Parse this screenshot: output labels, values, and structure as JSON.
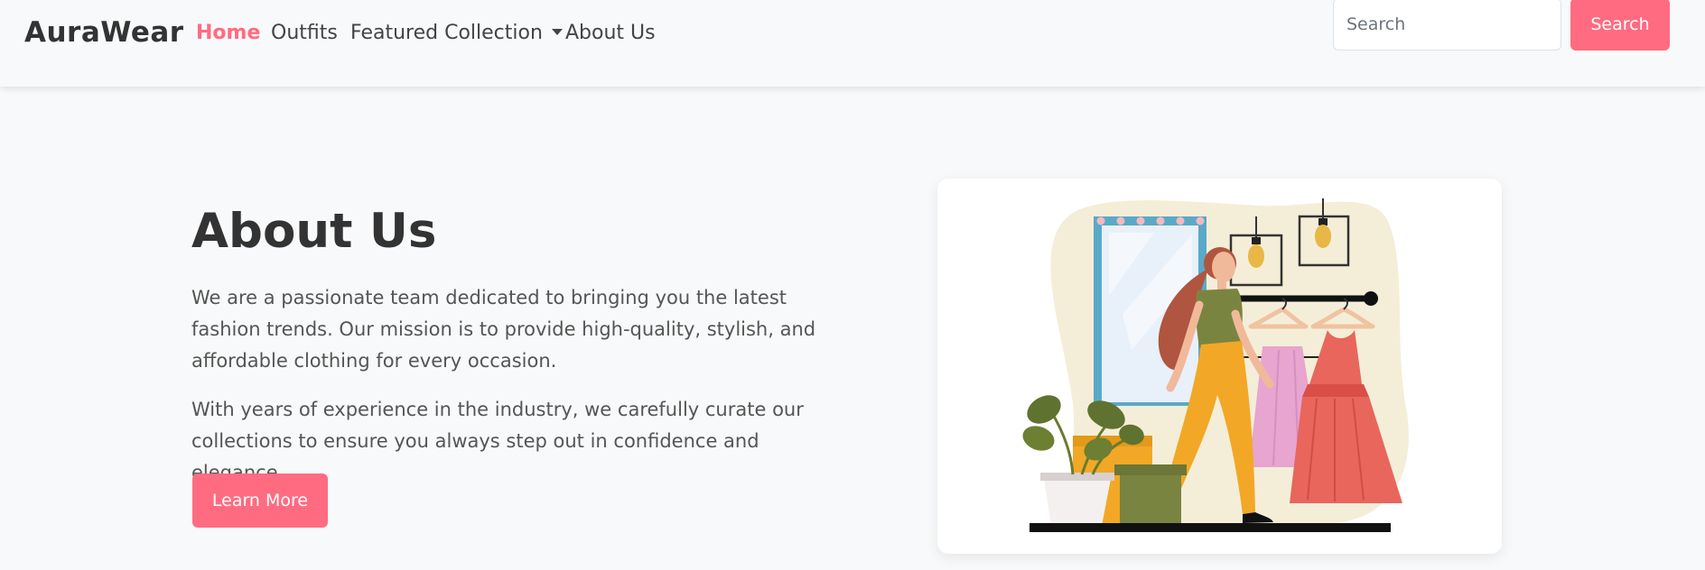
{
  "brand": "AuraWear",
  "nav": {
    "home": "Home",
    "outfits": "Outfits",
    "featured": "Featured Collection",
    "about": "About Us"
  },
  "search": {
    "placeholder": "Search",
    "button": "Search"
  },
  "about": {
    "title": "About Us",
    "paragraph1": "We are a passionate team dedicated to bringing you the latest fashion trends. Our mission is to provide high-quality, stylish, and affordable clothing for every occasion.",
    "paragraph2": "With years of experience in the industry, we carefully curate our collections to ensure you always step out in confidence and elegance.",
    "button": "Learn More"
  },
  "colors": {
    "accent": "#ff6b81",
    "background": "#f8f9fa",
    "text": "#333333"
  }
}
